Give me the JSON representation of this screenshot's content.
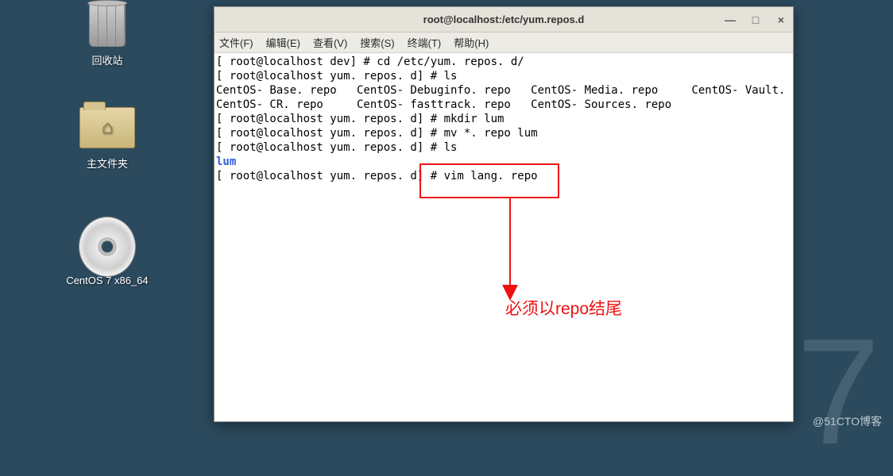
{
  "desktop": {
    "trash_label": "回收站",
    "home_label": "主文件夹",
    "cd_label": "CentOS 7 x86_64"
  },
  "window": {
    "title": "root@localhost:/etc/yum.repos.d",
    "min_hint": "—",
    "max_hint": "□",
    "close_hint": "×"
  },
  "menu": {
    "file": "文件(F)",
    "edit": "编辑(E)",
    "view": "查看(V)",
    "search": "搜索(S)",
    "terminal": "终端(T)",
    "help": "帮助(H)"
  },
  "term": {
    "l1": "[ root@localhost dev] # cd /etc/yum. repos. d/",
    "l2": "[ root@localhost yum. repos. d] # ls",
    "l3": "CentOS- Base. repo   CentOS- Debuginfo. repo   CentOS- Media. repo     CentOS- Vault. repo",
    "l4": "CentOS- CR. repo     CentOS- fasttrack. repo   CentOS- Sources. repo",
    "l5": "[ root@localhost yum. repos. d] # mkdir lum",
    "l6": "[ root@localhost yum. repos. d] # mv *. repo lum",
    "l7": "[ root@localhost yum. repos. d] # ls",
    "l8": "lum",
    "l9": "[ root@localhost yum. repos. d] # vim lang. repo"
  },
  "annotation": {
    "text": "必须以repo结尾"
  },
  "watermark": "@51CTO博客",
  "big7": "7"
}
